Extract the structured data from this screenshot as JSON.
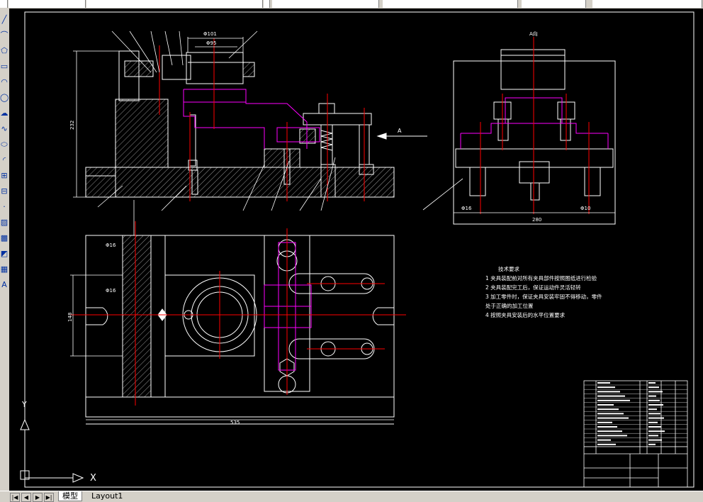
{
  "toolbar": {
    "icons": [
      "line-tool-icon",
      "polyline-tool-icon",
      "polygon-tool-icon",
      "rectangle-tool-icon",
      "arc-tool-icon",
      "circle-tool-icon",
      "revision-cloud-icon",
      "spline-tool-icon",
      "ellipse-tool-icon",
      "ellipse-arc-icon",
      "insert-block-icon",
      "make-block-icon",
      "point-tool-icon",
      "hatch-tool-icon",
      "gradient-tool-icon",
      "region-tool-icon",
      "table-tool-icon",
      "mtext-tool-icon"
    ],
    "glyphs": [
      "╱",
      "⌒",
      "⬠",
      "▭",
      "◠",
      "◯",
      "☁",
      "∿",
      "⬭",
      "◜",
      "⊞",
      "⊟",
      "·",
      "▨",
      "▩",
      "◩",
      "▦",
      "A"
    ]
  },
  "tabs": {
    "nav": [
      "|◀",
      "◀",
      "▶",
      "▶|"
    ],
    "model": "模型",
    "layout1": "Layout1"
  },
  "drawing": {
    "colors": {
      "outline": "#ffffff",
      "hidden": "#ff00ff",
      "center": "#ff0000",
      "cyan": "#00ffff",
      "yellow": "#ffff00",
      "background": "#000000"
    },
    "dims": {
      "d101": "Φ101",
      "d95": "Φ95",
      "h232": "232",
      "w280": "280",
      "w535": "535",
      "h148": "148",
      "d16a": "Φ16",
      "d16b": "Φ16",
      "d16c": "Φ16",
      "d10": "Φ10"
    },
    "view_label": "A向",
    "arrow_label": "A",
    "tech_notes": {
      "title": "技术要求",
      "lines": [
        "1   夹具装配前对所有夹具部件按照图纸进行检验",
        "2   夹具装配完工后，保证运动件灵活轻转",
        "3   加工零件时，保证夹具安装牢固不得移动，零件",
        "     处于正确的加工位置",
        "4   按照夹具安装后的水平位置要求"
      ]
    },
    "ucs": {
      "x": "X",
      "y": "Y"
    }
  }
}
